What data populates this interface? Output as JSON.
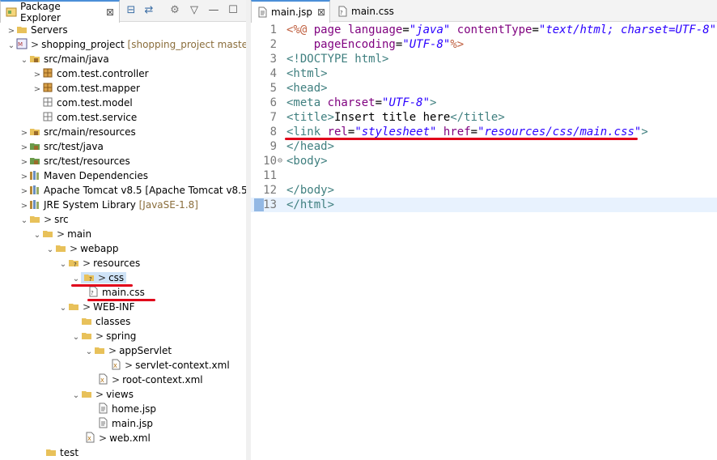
{
  "left_panel": {
    "tab_label": "Package Explorer",
    "tree": [
      {
        "label": "Servers"
      },
      {
        "label": "shopping_project",
        "suffix": "[shopping_project master]"
      },
      {
        "label": "src/main/java"
      },
      {
        "label": "com.test.controller"
      },
      {
        "label": "com.test.mapper"
      },
      {
        "label": "com.test.model"
      },
      {
        "label": "com.test.service"
      },
      {
        "label": "src/main/resources"
      },
      {
        "label": "src/test/java"
      },
      {
        "label": "src/test/resources"
      },
      {
        "label": "Maven Dependencies"
      },
      {
        "label": "Apache Tomcat v8.5",
        "suffix": "[Apache Tomcat v8.5]"
      },
      {
        "label": "JRE System Library",
        "suffix": "[JavaSE-1.8]"
      },
      {
        "label": "src",
        "prefix": ">"
      },
      {
        "label": "main",
        "prefix": ">"
      },
      {
        "label": "webapp",
        "prefix": ">"
      },
      {
        "label": "resources",
        "prefix": ">"
      },
      {
        "label": "css",
        "prefix": ">"
      },
      {
        "label": "main.css"
      },
      {
        "label": "WEB-INF",
        "prefix": ">"
      },
      {
        "label": "classes"
      },
      {
        "label": "spring",
        "prefix": ">"
      },
      {
        "label": "appServlet",
        "prefix": ">"
      },
      {
        "label": "servlet-context.xml",
        "prefix": ">"
      },
      {
        "label": "root-context.xml",
        "prefix": ">"
      },
      {
        "label": "views",
        "prefix": ">"
      },
      {
        "label": "home.jsp"
      },
      {
        "label": "main.jsp"
      },
      {
        "label": "web.xml",
        "prefix": ">"
      },
      {
        "label": "test"
      }
    ]
  },
  "editor": {
    "tabs": [
      {
        "label": "main.jsp",
        "close": "⊠"
      },
      {
        "label": "main.css"
      }
    ],
    "lines": [
      {
        "n": "1"
      },
      {
        "n": "2"
      },
      {
        "n": "3"
      },
      {
        "n": "4"
      },
      {
        "n": "5"
      },
      {
        "n": "6"
      },
      {
        "n": "7"
      },
      {
        "n": "8"
      },
      {
        "n": "9"
      },
      {
        "n": "10"
      },
      {
        "n": "11"
      },
      {
        "n": "12"
      },
      {
        "n": "13"
      }
    ],
    "code": {
      "l1": [
        "<%@ ",
        "page ",
        "language",
        "=",
        "\"java\"",
        " ",
        "contentType",
        "=",
        "\"text/html; charset=UTF-8\""
      ],
      "l2": [
        "    ",
        "pageEncoding",
        "=",
        "\"UTF-8\"",
        "%>"
      ],
      "l3": "<!DOCTYPE html>",
      "l4": "<html>",
      "l5": "<head>",
      "l6": [
        "<meta ",
        "charset",
        "=",
        "\"UTF-8\"",
        ">"
      ],
      "l7": [
        "<title>",
        "Insert title here",
        "</title>"
      ],
      "l8": [
        "<link ",
        "rel",
        "=",
        "\"stylesheet\"",
        " ",
        "href",
        "=",
        "\"resources/css/main.css\"",
        ">"
      ],
      "l9": "</head>",
      "l10": "<body>",
      "l11": "",
      "l12": "</body>",
      "l13": "</html>"
    }
  },
  "colors": {
    "annotation": "#e0001a",
    "tab_accent": "#4b8fd8"
  }
}
